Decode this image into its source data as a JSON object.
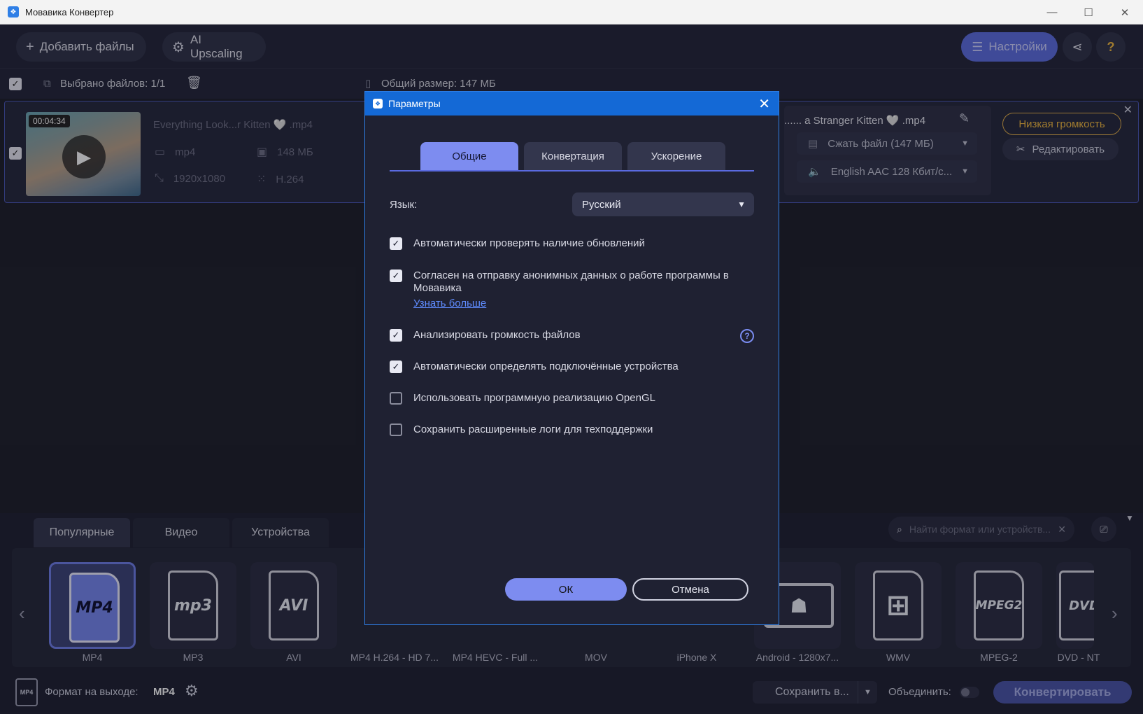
{
  "window": {
    "title": "Мовавика Конвертер",
    "minimize": "—",
    "maximize": "☐",
    "close": "✕"
  },
  "toolbar": {
    "add_files_label": "Добавить файлы",
    "ai_upscaling_label": "AI Upscaling",
    "settings_label": "Настройки"
  },
  "selection_bar": {
    "selected_files": "Выбрано файлов: 1/1",
    "total_size": "Общий размер: 147 МБ"
  },
  "file": {
    "duration": "00:04:34",
    "source_name": "Everything Look...r Kitten 🤍 .mp4",
    "source_container": "mp4",
    "source_size": "148 МБ",
    "source_resolution": "1920x1080",
    "source_codec": "H.264",
    "output_name": "...... a Stranger Kitten 🤍 .mp4",
    "compress_label": "Сжать файл (147 МБ)",
    "audio_label": "English AAC 128 Кбит/с...",
    "low_volume_label": "Низкая громкость",
    "edit_label": "Редактировать"
  },
  "format_panel": {
    "tabs": [
      "Популярные",
      "Видео",
      "Устройства"
    ],
    "search_placeholder": "Найти формат или устройств...",
    "items": [
      {
        "label": "MP4",
        "icon_text": "MP4"
      },
      {
        "label": "MP3",
        "icon_text": "mp3"
      },
      {
        "label": "AVI",
        "icon_text": "AVI"
      },
      {
        "label": "MP4 H.264 - HD 7..."
      },
      {
        "label": "MP4 HEVC - Full ..."
      },
      {
        "label": "MOV"
      },
      {
        "label": "iPhone X"
      },
      {
        "label": "Android - 1280x7..."
      },
      {
        "label": "WMV"
      },
      {
        "label": "MPEG-2",
        "icon_text": "MPEG2"
      },
      {
        "label": "DVD - NT",
        "icon_text": "DVD"
      }
    ]
  },
  "bottom_bar": {
    "output_format_label": "Формат на выходе:",
    "output_format_value": "MP4",
    "save_to_label": "Сохранить в...",
    "merge_label": "Объединить:",
    "convert_label": "Конвертировать"
  },
  "dialog": {
    "title": "Параметры",
    "tabs": [
      "Общие",
      "Конвертация",
      "Ускорение"
    ],
    "active_tab": "Общие",
    "language_label": "Язык:",
    "language_value": "Русский",
    "options": [
      {
        "label": "Автоматически проверять наличие обновлений",
        "checked": true
      },
      {
        "label": "Согласен на отправку анонимных данных о работе программы в Мовавика",
        "checked": true,
        "link": "Узнать больше"
      },
      {
        "label": "Анализировать громкость файлов",
        "checked": true
      },
      {
        "label": "Автоматически определять подключённые устройства",
        "checked": true
      },
      {
        "label": "Использовать программную реализацию OpenGL",
        "checked": false
      },
      {
        "label": "Сохранить расширенные логи для техподдержки",
        "checked": false
      }
    ],
    "ok_label": "ОК",
    "cancel_label": "Отмена"
  },
  "colors": {
    "accent": "#7d8cf0",
    "title_bar": "#1469d6",
    "warning": "#f1b93f",
    "background": "#1e1f2a"
  }
}
